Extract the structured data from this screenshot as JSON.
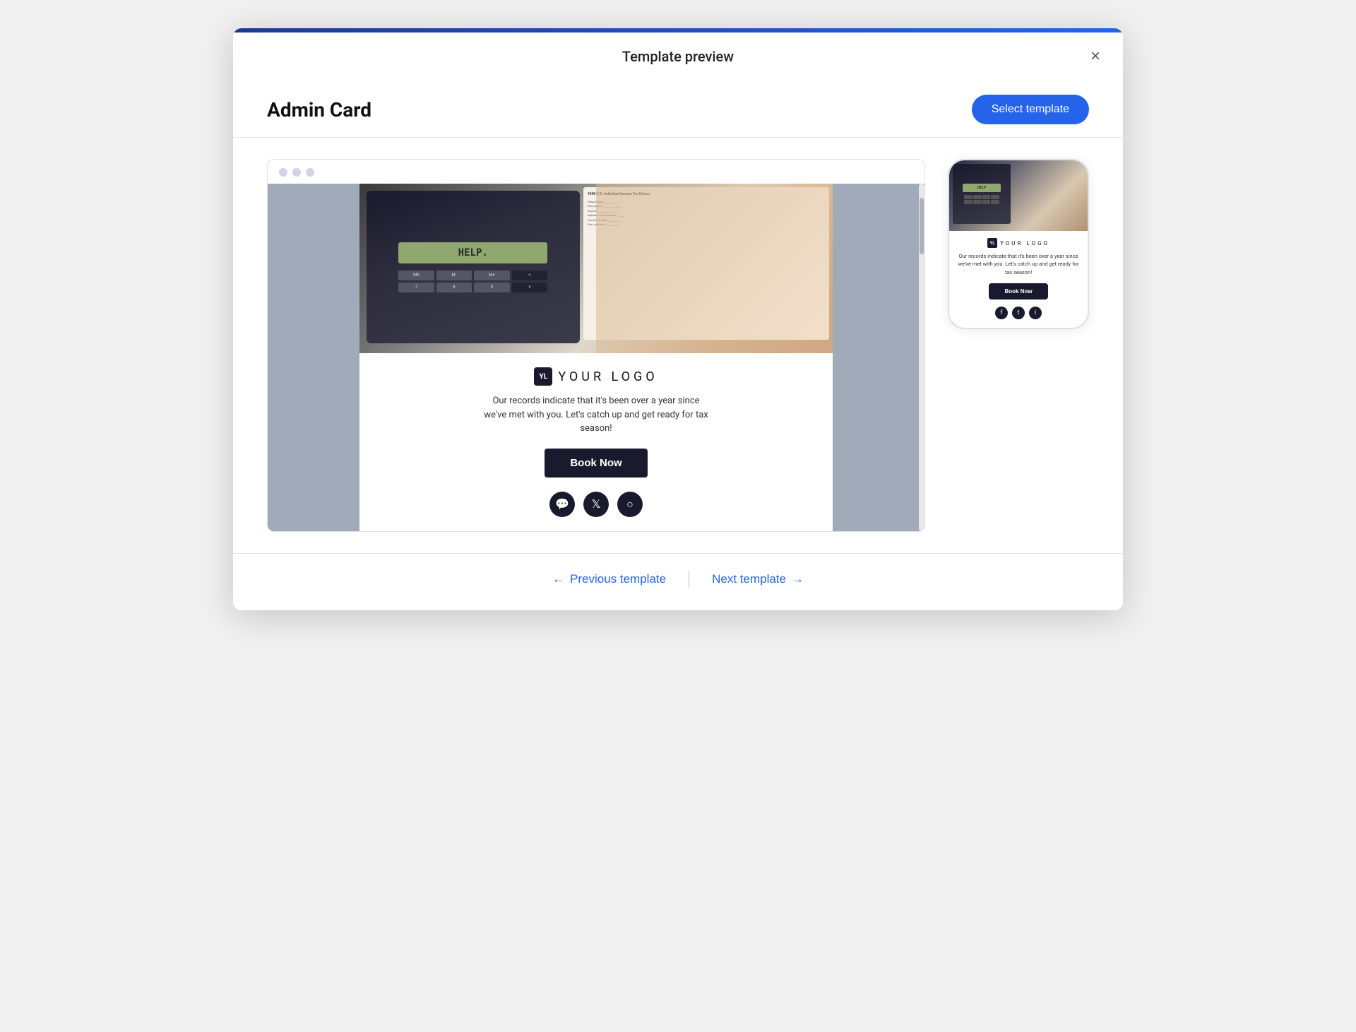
{
  "header": {
    "title": "Template preview",
    "close_label": "×"
  },
  "subheader": {
    "template_name": "Admin Card",
    "select_button_label": "Select template"
  },
  "desktop_preview": {
    "dots": [
      "dot1",
      "dot2",
      "dot3"
    ],
    "hero_calc_text": "HELP.",
    "logo_initials": "YL",
    "logo_text": "YOUR  LOGO",
    "body_text": "Our records indicate that it's been over a year since we've met with you. Let's catch up and get ready for tax season!",
    "book_button_label": "Book Now",
    "social_icons": [
      "facebook",
      "twitter",
      "instagram"
    ]
  },
  "mobile_preview": {
    "logo_initials": "YL",
    "logo_text": "YOUR  LOGO",
    "body_text": "Our records indicate that it's been over a year since we've met with you. Let's catch up and get ready for tax season!",
    "book_button_label": "Book Now",
    "social_icons": [
      "facebook",
      "twitter",
      "instagram"
    ]
  },
  "footer": {
    "previous_label": "Previous template",
    "next_label": "Next template"
  }
}
